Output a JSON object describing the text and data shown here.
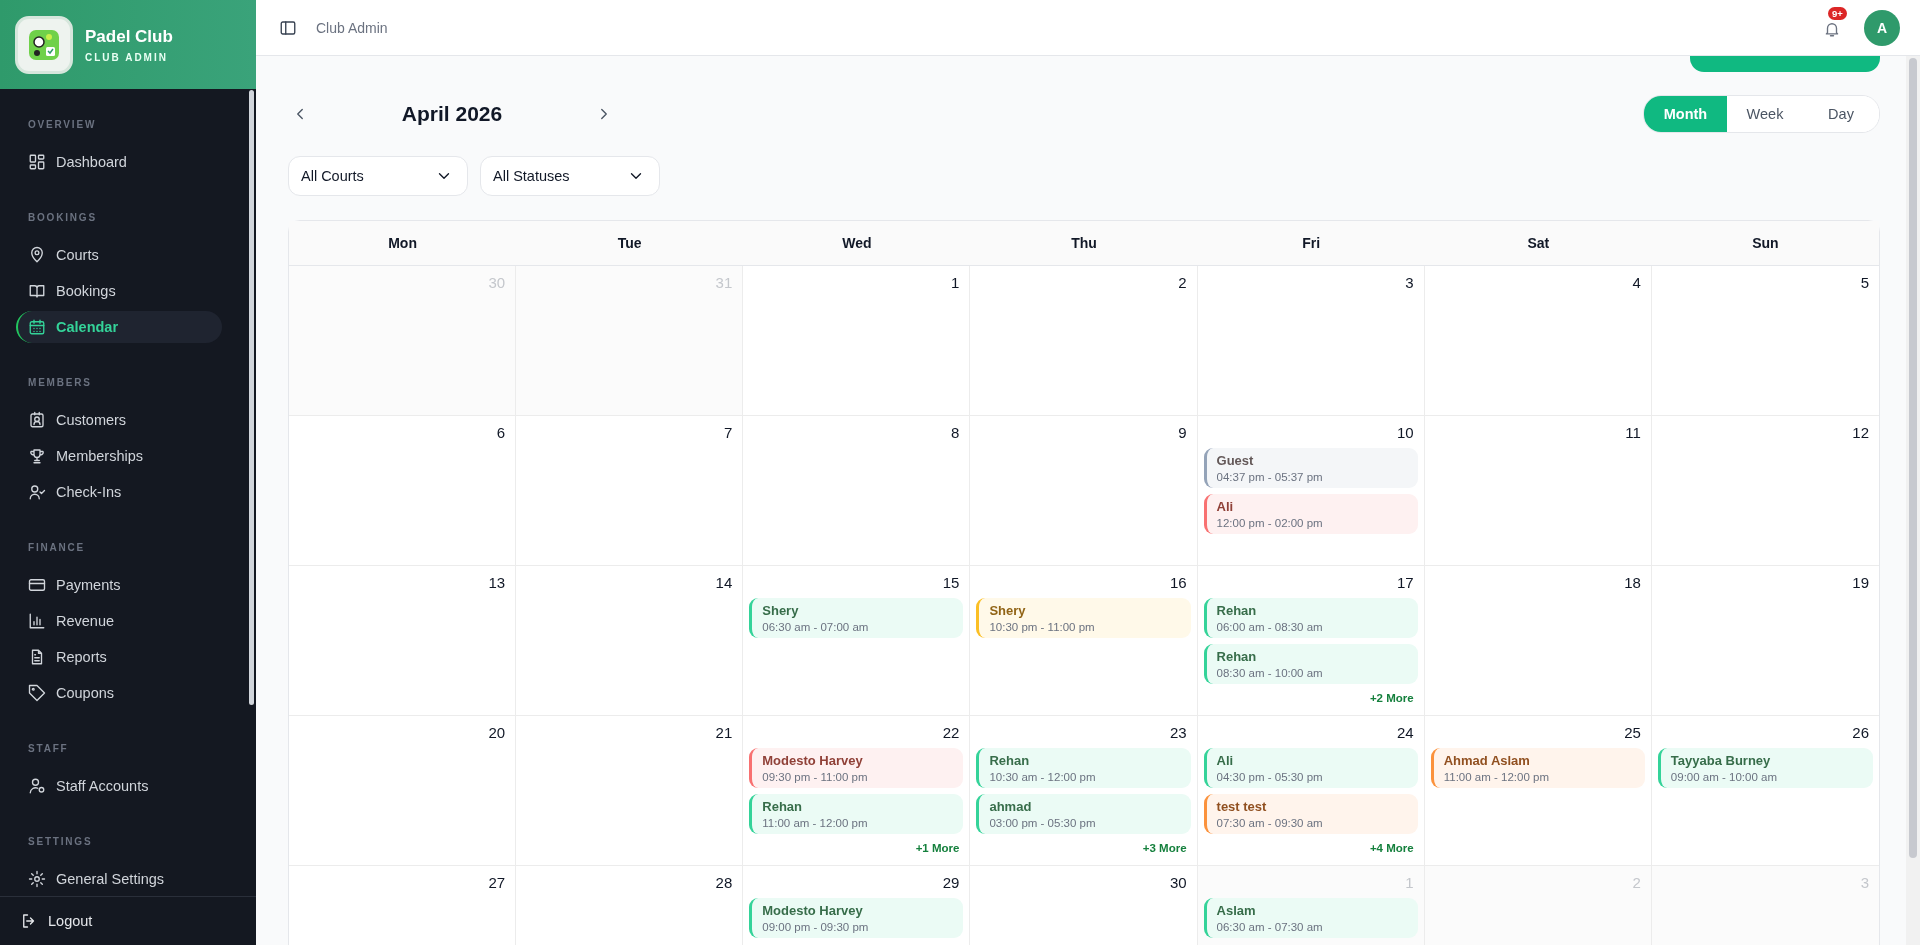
{
  "sidebar": {
    "brand": {
      "title": "Padel Club",
      "subtitle": "CLUB ADMIN"
    },
    "sections": [
      {
        "label": "OVERVIEW",
        "items": [
          {
            "label": "Dashboard",
            "selected": false
          }
        ]
      },
      {
        "label": "BOOKINGS",
        "items": [
          {
            "label": "Courts",
            "selected": false
          },
          {
            "label": "Bookings",
            "selected": false
          },
          {
            "label": "Calendar",
            "selected": true
          }
        ]
      },
      {
        "label": "MEMBERS",
        "items": [
          {
            "label": "Customers",
            "selected": false
          },
          {
            "label": "Memberships",
            "selected": false
          },
          {
            "label": "Check-Ins",
            "selected": false
          }
        ]
      },
      {
        "label": "FINANCE",
        "items": [
          {
            "label": "Payments",
            "selected": false
          },
          {
            "label": "Revenue",
            "selected": false
          },
          {
            "label": "Reports",
            "selected": false
          },
          {
            "label": "Coupons",
            "selected": false
          }
        ]
      },
      {
        "label": "STAFF",
        "items": [
          {
            "label": "Staff Accounts",
            "selected": false
          }
        ]
      },
      {
        "label": "SETTINGS",
        "items": [
          {
            "label": "General Settings",
            "selected": false
          }
        ]
      }
    ],
    "logout": "Logout"
  },
  "header": {
    "breadcrumb": "Club Admin",
    "notification_badge": "9+",
    "avatar": "A"
  },
  "toolbar": {
    "month": "April 2026",
    "views": [
      {
        "label": "Month",
        "selected": true
      },
      {
        "label": "Week",
        "selected": false
      },
      {
        "label": "Day",
        "selected": false
      }
    ],
    "filters": [
      {
        "value": "All Courts"
      },
      {
        "value": "All Statuses"
      }
    ]
  },
  "calendar": {
    "weekdays": [
      "Mon",
      "Tue",
      "Wed",
      "Thu",
      "Fri",
      "Sat",
      "Sun"
    ],
    "days": [
      {
        "day": "30",
        "current_month": false
      },
      {
        "day": "31",
        "current_month": false
      },
      {
        "day": "1",
        "current_month": true
      },
      {
        "day": "2",
        "current_month": true
      },
      {
        "day": "3",
        "current_month": true
      },
      {
        "day": "4",
        "current_month": true
      },
      {
        "day": "5",
        "current_month": true
      },
      {
        "day": "6",
        "current_month": true
      },
      {
        "day": "7",
        "current_month": true
      },
      {
        "day": "8",
        "current_month": true
      },
      {
        "day": "9",
        "current_month": true
      },
      {
        "day": "10",
        "current_month": true,
        "events": [
          {
            "name": "Guest",
            "time": "04:37 pm - 05:37 pm",
            "color": "#94a3b8"
          },
          {
            "name": "Ali",
            "time": "12:00 pm - 02:00 pm",
            "color": "#f87171"
          }
        ]
      },
      {
        "day": "11",
        "current_month": true
      },
      {
        "day": "12",
        "current_month": true
      },
      {
        "day": "13",
        "current_month": true
      },
      {
        "day": "14",
        "current_month": true
      },
      {
        "day": "15",
        "current_month": true,
        "events": [
          {
            "name": "Shery",
            "time": "06:30 am - 07:00 am",
            "color": "#34d399"
          }
        ]
      },
      {
        "day": "16",
        "current_month": true,
        "events": [
          {
            "name": "Shery",
            "time": "10:30 pm - 11:00 pm",
            "color": "#fbbf24"
          }
        ]
      },
      {
        "day": "17",
        "current_month": true,
        "events": [
          {
            "name": "Rehan",
            "time": "06:00 am - 08:30 am",
            "color": "#34d399"
          },
          {
            "name": "Rehan",
            "time": "08:30 am - 10:00 am",
            "color": "#34d399"
          }
        ],
        "more": "+2 More"
      },
      {
        "day": "18",
        "current_month": true
      },
      {
        "day": "19",
        "current_month": true
      },
      {
        "day": "20",
        "current_month": true
      },
      {
        "day": "21",
        "current_month": true
      },
      {
        "day": "22",
        "current_month": true,
        "events": [
          {
            "name": "Modesto Harvey",
            "time": "09:30 pm - 11:00 pm",
            "color": "#f87171"
          },
          {
            "name": "Rehan",
            "time": "11:00 am - 12:00 pm",
            "color": "#34d399"
          }
        ],
        "more": "+1 More"
      },
      {
        "day": "23",
        "current_month": true,
        "events": [
          {
            "name": "Rehan",
            "time": "10:30 am - 12:00 pm",
            "color": "#34d399"
          },
          {
            "name": "ahmad",
            "time": "03:00 pm - 05:30 pm",
            "color": "#34d399"
          }
        ],
        "more": "+3 More"
      },
      {
        "day": "24",
        "current_month": true,
        "events": [
          {
            "name": "Ali",
            "time": "04:30 pm - 05:30 pm",
            "color": "#34d399"
          },
          {
            "name": "test test",
            "time": "07:30 am - 09:30 am",
            "color": "#fb923c"
          }
        ],
        "more": "+4 More"
      },
      {
        "day": "25",
        "current_month": true,
        "events": [
          {
            "name": "Ahmad Aslam",
            "time": "11:00 am - 12:00 pm",
            "color": "#fb923c"
          }
        ]
      },
      {
        "day": "26",
        "current_month": true,
        "events": [
          {
            "name": "Tayyaba Burney",
            "time": "09:00 am - 10:00 am",
            "color": "#34d399"
          }
        ]
      },
      {
        "day": "27",
        "current_month": true
      },
      {
        "day": "28",
        "current_month": true
      },
      {
        "day": "29",
        "current_month": true,
        "events": [
          {
            "name": "Modesto Harvey",
            "time": "09:00 pm - 09:30 pm",
            "color": "#34d399"
          }
        ]
      },
      {
        "day": "30",
        "current_month": true
      },
      {
        "day": "1",
        "current_month": false,
        "events": [
          {
            "name": "Aslam",
            "time": "06:30 am - 07:30 am",
            "color": "#34d399"
          }
        ]
      },
      {
        "day": "2",
        "current_month": false
      },
      {
        "day": "3",
        "current_month": false
      }
    ]
  }
}
